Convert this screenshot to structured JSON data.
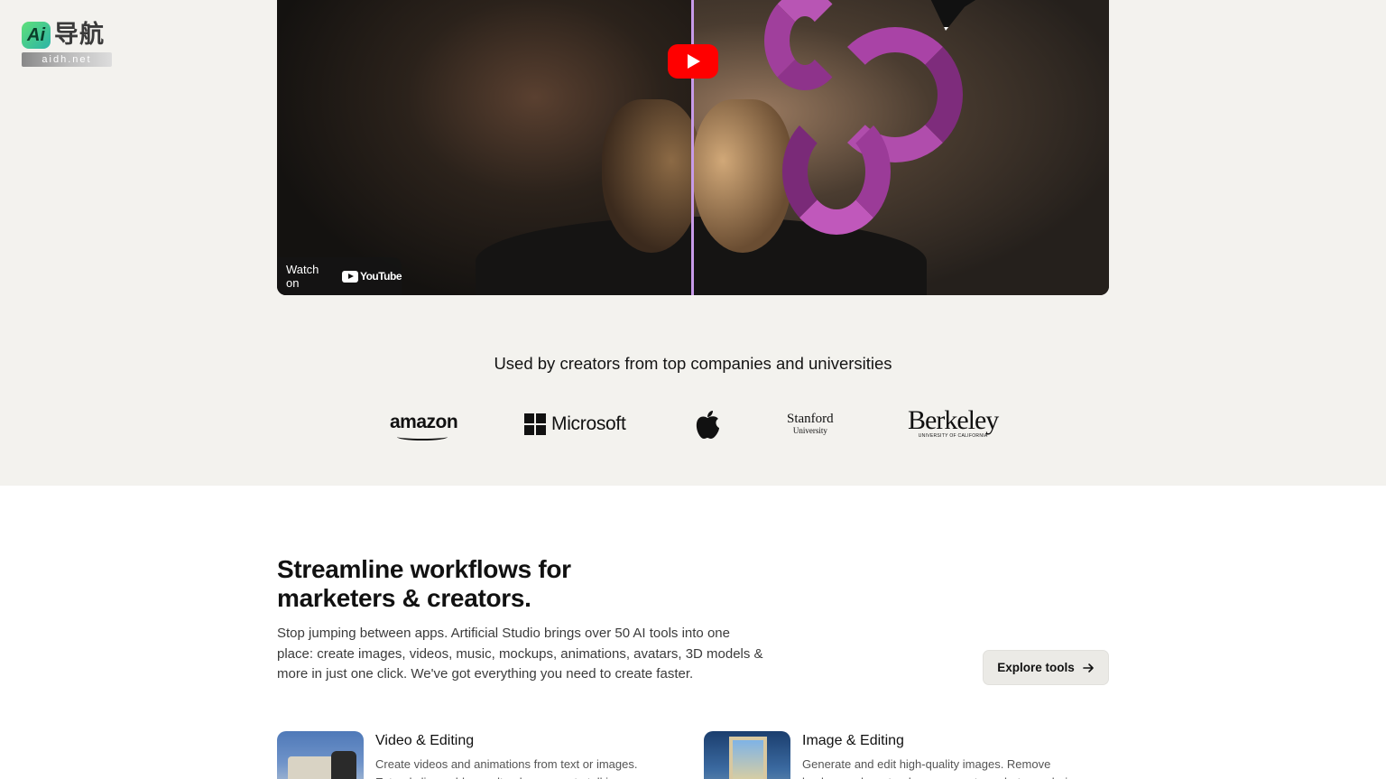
{
  "watermark": {
    "badge": "Ai",
    "brand_cn": "导航",
    "domain": "aidh.net"
  },
  "video": {
    "watch_on": "Watch on",
    "youtube": "YouTube"
  },
  "trust": {
    "heading": "Used by creators from top companies and universities",
    "logos": {
      "amazon": "amazon",
      "microsoft": "Microsoft",
      "apple": "apple-logo",
      "stanford": "Stanford",
      "stanford_sub": "University",
      "berkeley": "Berkeley",
      "berkeley_sub": "UNIVERSITY OF CALIFORNIA"
    }
  },
  "section": {
    "headline_line1": "Streamline workflows for",
    "headline_line2": "marketers & creators.",
    "description": "Stop jumping between apps. Artificial Studio brings over 50 AI tools into one place: create images, videos, music, mockups, animations, avatars, 3D models & more in just one click. We've got everything you need to create faster.",
    "cta": "Explore tools",
    "cta_icon": "arrow-right-icon"
  },
  "cards": [
    {
      "title": "Video & Editing",
      "text": "Create videos and animations from text or images. Extend clips, add soundtracks, generate talking"
    },
    {
      "title": "Image & Editing",
      "text": "Generate and edit high-quality images. Remove backgrounds, extend scenes, restore photos, colorize"
    }
  ],
  "colors": {
    "band_bg": "#f3f2ee",
    "youtube_red": "#ff0000",
    "divider": "#c79ae8",
    "tentacle": "#a43ea0"
  }
}
